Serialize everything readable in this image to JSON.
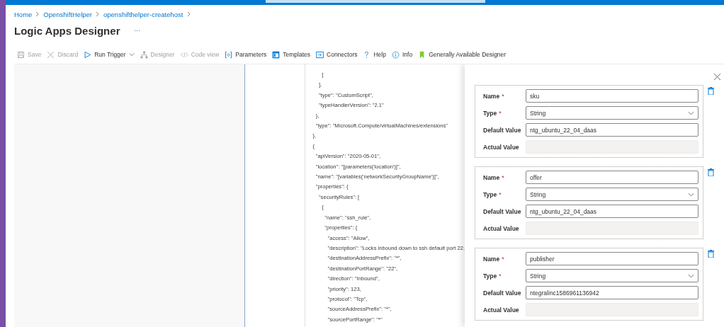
{
  "breadcrumb": [
    {
      "label": "Home"
    },
    {
      "label": "OpenshiftHelper"
    },
    {
      "label": "openshifthelper-createhost"
    }
  ],
  "page": {
    "title": "Logic Apps Designer",
    "more": "···"
  },
  "toolbar": [
    {
      "kind": "save",
      "label": "Save",
      "disabled": true
    },
    {
      "kind": "discard",
      "label": "Discard",
      "disabled": true
    },
    {
      "kind": "run",
      "label": "Run Trigger",
      "disabled": false
    },
    {
      "kind": "designer",
      "label": "Designer",
      "disabled": true
    },
    {
      "kind": "code",
      "label": "Code view",
      "disabled": true
    },
    {
      "kind": "parameters",
      "label": "Parameters",
      "disabled": false
    },
    {
      "kind": "templates",
      "label": "Templates",
      "disabled": false
    },
    {
      "kind": "connectors",
      "label": "Connectors",
      "disabled": false
    },
    {
      "kind": "help",
      "label": "Help",
      "disabled": false
    },
    {
      "kind": "info",
      "label": "Info",
      "disabled": false
    },
    {
      "kind": "ga",
      "label": "Generally Available Designer",
      "disabled": false
    }
  ],
  "code_lines": [
    "        ]",
    "      ],",
    "      \"type\": \"CustomScript\",",
    "      \"typeHandlerVersion\": \"2.1\"",
    "    },",
    "    \"type\": \"Microsoft.Compute/virtualMachines/extensions\"",
    "  },",
    "  {",
    "    \"apiVersion\": \"2020-05-01\",",
    "    \"location\": \"[parameters('location')]\",",
    "    \"name\": \"[variables('networkSecurityGroupName')]\",",
    "    \"properties\": {",
    "      \"securityRules\": [",
    "        {",
    "          \"name\": \"ssh_rule\",",
    "          \"properties\": {",
    "            \"access\": \"Allow\",",
    "            \"description\": \"Locks inbound down to ssh default port 22.",
    "            \"destinationAddressPrefix\": \"*\",",
    "            \"destinationPortRange\": \"22\",",
    "            \"direction\": \"Inbound\",",
    "            \"priority\": 123,",
    "            \"protocol\": \"Tcp\",",
    "            \"sourceAddressPrefix\": \"*\",",
    "            \"sourcePortRange\": \"*\""
  ],
  "parameters": [
    {
      "fields": [
        {
          "kind": "text",
          "label": "Name",
          "required_mark": "*",
          "value": "sku"
        },
        {
          "kind": "select",
          "label": "Type",
          "required_mark": "*",
          "value": "String"
        },
        {
          "kind": "text",
          "label": "Default Value",
          "value": "ntg_ubuntu_22_04_daas"
        },
        {
          "kind": "readonly",
          "label": "Actual Value"
        }
      ]
    },
    {
      "fields": [
        {
          "kind": "text",
          "label": "Name",
          "required_mark": "*",
          "value": "offer"
        },
        {
          "kind": "select",
          "label": "Type",
          "required_mark": "*",
          "value": "String"
        },
        {
          "kind": "text",
          "label": "Default Value",
          "value": "ntg_ubuntu_22_04_daas"
        },
        {
          "kind": "readonly",
          "label": "Actual Value"
        }
      ]
    },
    {
      "fields": [
        {
          "kind": "text",
          "label": "Name",
          "required_mark": "*",
          "value": "publisher"
        },
        {
          "kind": "select",
          "label": "Type",
          "required_mark": "*",
          "value": "String"
        },
        {
          "kind": "text",
          "label": "Default Value",
          "value": "ntegralinc1586961136942"
        },
        {
          "kind": "readonly",
          "label": "Actual Value"
        }
      ]
    }
  ]
}
